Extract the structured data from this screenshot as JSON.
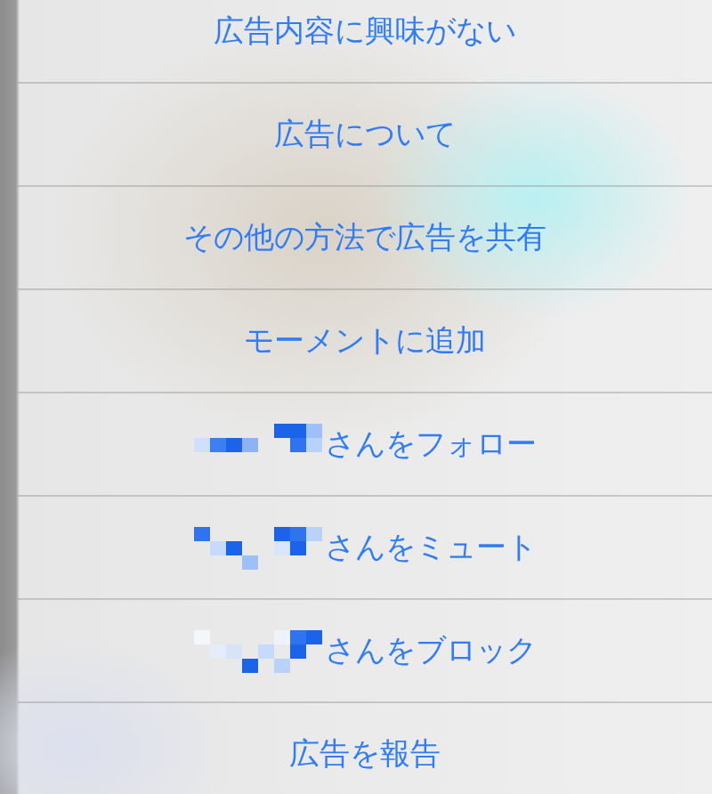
{
  "action_sheet": {
    "items": [
      {
        "label": "広告内容に興味がない",
        "kind": "plain"
      },
      {
        "label": "広告について",
        "kind": "plain"
      },
      {
        "label": "その他の方法で広告を共有",
        "kind": "plain"
      },
      {
        "label": "モーメントに追加",
        "kind": "plain"
      },
      {
        "label": "さんをフォロー",
        "kind": "redacted"
      },
      {
        "label": "さんをミュート",
        "kind": "redacted"
      },
      {
        "label": "さんをブロック",
        "kind": "redacted"
      },
      {
        "label": "広告を報告",
        "kind": "plain"
      }
    ]
  }
}
